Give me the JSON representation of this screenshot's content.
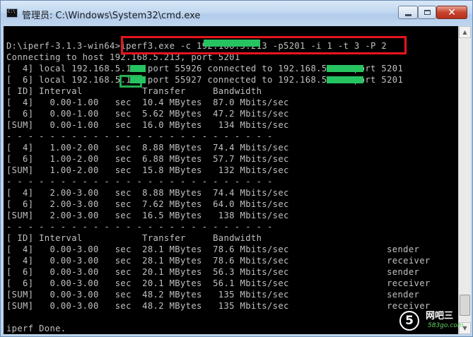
{
  "window": {
    "title": "管理员: C:\\Windows\\System32\\cmd.exe",
    "icon": "cmd-console-icon",
    "controls": [
      "minimize",
      "maximize",
      "close"
    ]
  },
  "console": {
    "lines": [
      "D:\\iperf-3.1.3-win64>iperf3.exe -c 192.168.5.213 -p5201 -i 1 -t 3 -P 2",
      "Connecting to host 192.168.5.213, port 5201",
      "[  4] local 192.168.5.106 port 55926 connected to 192.168.5.213 port 5201",
      "[  6] local 192.168.5.106 port 55927 connected to 192.168.5.213 port 5201",
      "[ ID] Interval           Transfer     Bandwidth",
      "[  4]   0.00-1.00   sec  10.4 MBytes  87.0 Mbits/sec",
      "[  6]   0.00-1.00   sec  5.62 MBytes  47.2 Mbits/sec",
      "[SUM]   0.00-1.00   sec  16.0 MBytes   134 Mbits/sec",
      "- - - - - - - - - - - - - - - - - - - - - - - - -",
      "[  4]   1.00-2.00   sec  8.88 MBytes  74.4 Mbits/sec",
      "[  6]   1.00-2.00   sec  6.88 MBytes  57.7 Mbits/sec",
      "[SUM]   1.00-2.00   sec  15.8 MBytes   132 Mbits/sec",
      "- - - - - - - - - - - - - - - - - - - - - - - - -",
      "[  4]   2.00-3.00   sec  8.88 MBytes  74.4 Mbits/sec",
      "[  6]   2.00-3.00   sec  7.62 MBytes  64.0 Mbits/sec",
      "[SUM]   2.00-3.00   sec  16.5 MBytes   138 Mbits/sec",
      "- - - - - - - - - - - - - - - - - - - - - - - - -",
      "[ ID] Interval           Transfer     Bandwidth",
      "[  4]   0.00-3.00   sec  28.1 MBytes  78.6 Mbits/sec                  sender",
      "[  4]   0.00-3.00   sec  28.1 MBytes  78.6 Mbits/sec                  receiver",
      "[  6]   0.00-3.00   sec  20.1 MBytes  56.3 Mbits/sec                  sender",
      "[  6]   0.00-3.00   sec  20.1 MBytes  56.1 Mbits/sec                  receiver",
      "[SUM]   0.00-3.00   sec  48.2 MBytes   135 Mbits/sec                  sender",
      "[SUM]   0.00-3.00   sec  48.2 MBytes   135 Mbits/sec                  receiver",
      "",
      "iperf Done."
    ]
  },
  "annotations": {
    "command_highlight_color": "#e8141d",
    "port_highlight_color": "#25ad4f",
    "redaction_color": "#26c460"
  },
  "watermark": {
    "badge": "5",
    "name": "网吧三",
    "domain": "583go.com"
  }
}
